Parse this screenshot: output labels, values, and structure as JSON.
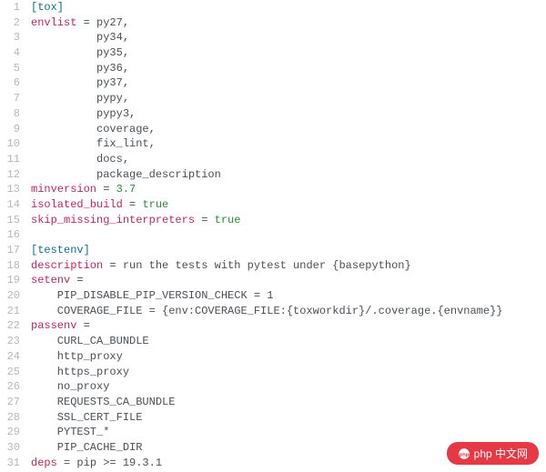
{
  "badge": {
    "text": "php 中文网"
  },
  "lines": [
    {
      "n": "1",
      "segs": [
        {
          "c": "k-section",
          "t": "[tox]"
        }
      ]
    },
    {
      "n": "2",
      "segs": [
        {
          "c": "k-key",
          "t": "envlist"
        },
        {
          "c": "k-eq",
          "t": " = "
        },
        {
          "c": "k-val",
          "t": "py27,"
        }
      ]
    },
    {
      "n": "3",
      "segs": [
        {
          "c": "k-val",
          "t": "          py34,"
        }
      ]
    },
    {
      "n": "4",
      "segs": [
        {
          "c": "k-val",
          "t": "          py35,"
        }
      ]
    },
    {
      "n": "5",
      "segs": [
        {
          "c": "k-val",
          "t": "          py36,"
        }
      ]
    },
    {
      "n": "6",
      "segs": [
        {
          "c": "k-val",
          "t": "          py37,"
        }
      ]
    },
    {
      "n": "7",
      "segs": [
        {
          "c": "k-val",
          "t": "          pypy,"
        }
      ]
    },
    {
      "n": "8",
      "segs": [
        {
          "c": "k-val",
          "t": "          pypy3,"
        }
      ]
    },
    {
      "n": "9",
      "segs": [
        {
          "c": "k-val",
          "t": "          coverage,"
        }
      ]
    },
    {
      "n": "10",
      "segs": [
        {
          "c": "k-val",
          "t": "          fix_lint,"
        }
      ]
    },
    {
      "n": "11",
      "segs": [
        {
          "c": "k-val",
          "t": "          docs,"
        }
      ]
    },
    {
      "n": "12",
      "segs": [
        {
          "c": "k-val",
          "t": "          package_description"
        }
      ]
    },
    {
      "n": "13",
      "segs": [
        {
          "c": "k-key",
          "t": "minversion"
        },
        {
          "c": "k-eq",
          "t": " = "
        },
        {
          "c": "k-lit",
          "t": "3.7"
        }
      ]
    },
    {
      "n": "14",
      "segs": [
        {
          "c": "k-key",
          "t": "isolated_build"
        },
        {
          "c": "k-eq",
          "t": " = "
        },
        {
          "c": "k-lit",
          "t": "true"
        }
      ]
    },
    {
      "n": "15",
      "segs": [
        {
          "c": "k-key",
          "t": "skip_missing_interpreters"
        },
        {
          "c": "k-eq",
          "t": " = "
        },
        {
          "c": "k-lit",
          "t": "true"
        }
      ]
    },
    {
      "n": "16",
      "segs": []
    },
    {
      "n": "17",
      "segs": [
        {
          "c": "k-section",
          "t": "[testenv]"
        }
      ]
    },
    {
      "n": "18",
      "segs": [
        {
          "c": "k-key",
          "t": "description"
        },
        {
          "c": "k-eq",
          "t": " = "
        },
        {
          "c": "k-val",
          "t": "run the tests with pytest under {basepython}"
        }
      ]
    },
    {
      "n": "19",
      "segs": [
        {
          "c": "k-key",
          "t": "setenv"
        },
        {
          "c": "k-eq",
          "t": " ="
        }
      ]
    },
    {
      "n": "20",
      "segs": [
        {
          "c": "k-val",
          "t": "    PIP_DISABLE_PIP_VERSION_CHECK = 1"
        }
      ]
    },
    {
      "n": "21",
      "segs": [
        {
          "c": "k-val",
          "t": "    COVERAGE_FILE = {env:COVERAGE_FILE:{toxworkdir}/.coverage.{envname}}"
        }
      ]
    },
    {
      "n": "22",
      "segs": [
        {
          "c": "k-key",
          "t": "passenv"
        },
        {
          "c": "k-eq",
          "t": " ="
        }
      ]
    },
    {
      "n": "23",
      "segs": [
        {
          "c": "k-val",
          "t": "    CURL_CA_BUNDLE"
        }
      ]
    },
    {
      "n": "24",
      "segs": [
        {
          "c": "k-val",
          "t": "    http_proxy"
        }
      ]
    },
    {
      "n": "25",
      "segs": [
        {
          "c": "k-val",
          "t": "    https_proxy"
        }
      ]
    },
    {
      "n": "26",
      "segs": [
        {
          "c": "k-val",
          "t": "    no_proxy"
        }
      ]
    },
    {
      "n": "27",
      "segs": [
        {
          "c": "k-val",
          "t": "    REQUESTS_CA_BUNDLE"
        }
      ]
    },
    {
      "n": "28",
      "segs": [
        {
          "c": "k-val",
          "t": "    SSL_CERT_FILE"
        }
      ]
    },
    {
      "n": "29",
      "segs": [
        {
          "c": "k-val",
          "t": "    PYTEST_*"
        }
      ]
    },
    {
      "n": "30",
      "segs": [
        {
          "c": "k-val",
          "t": "    PIP_CACHE_DIR"
        }
      ]
    },
    {
      "n": "31",
      "segs": [
        {
          "c": "k-key",
          "t": "deps"
        },
        {
          "c": "k-eq",
          "t": " = "
        },
        {
          "c": "k-val",
          "t": "pip >= 19.3.1"
        }
      ]
    }
  ]
}
